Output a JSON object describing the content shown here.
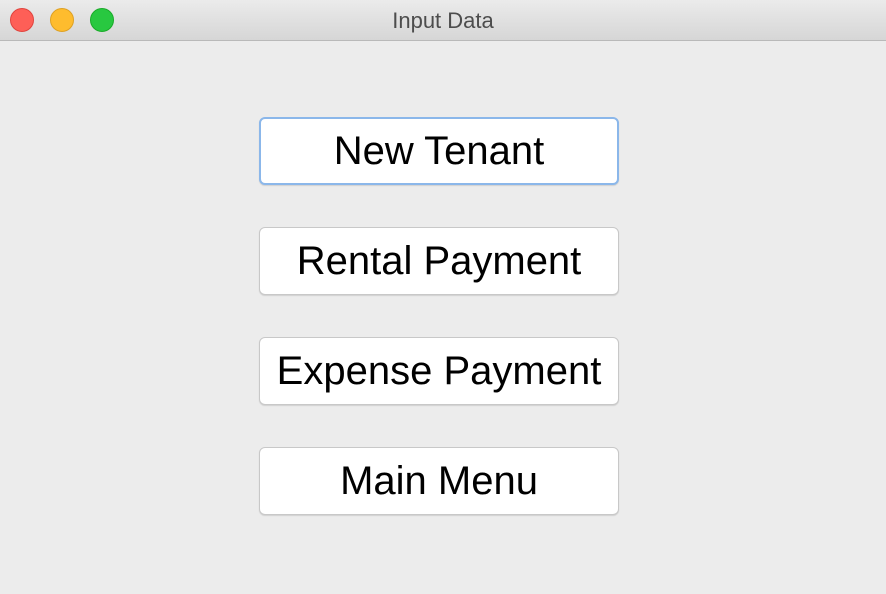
{
  "window": {
    "title": "Input Data"
  },
  "buttons": {
    "new_tenant": "New Tenant",
    "rental_payment": "Rental Payment",
    "expense_payment": "Expense Payment",
    "main_menu": "Main Menu"
  },
  "colors": {
    "close": "#fe5f57",
    "minimize": "#febc2e",
    "zoom": "#28c840",
    "focus_ring": "#8bb7ea",
    "background": "#ececec"
  }
}
